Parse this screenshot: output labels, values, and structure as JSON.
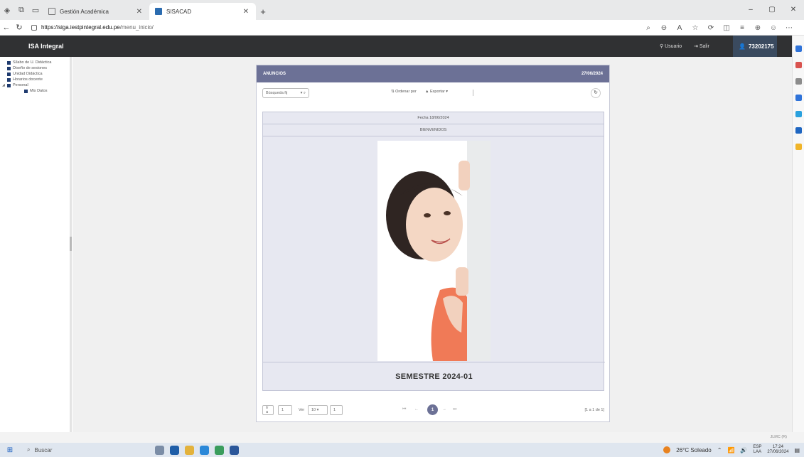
{
  "browser": {
    "tabs": [
      {
        "label": "Gestión Académica",
        "active": false
      },
      {
        "label": "SISACAD",
        "active": true
      }
    ],
    "new_tab": "+",
    "url_host": "https://siga.iestpintegral.edu.pe",
    "url_path": "/menu_inicio/",
    "win_min": "–",
    "win_max": "▢",
    "win_close": "✕"
  },
  "header": {
    "brand": "ISA Integral",
    "usuario": "Usuario",
    "salir": "Salir",
    "user_code": "73202175"
  },
  "sidebar": {
    "items": [
      {
        "label": "Sílabo de U. Didáctica",
        "level": 1
      },
      {
        "label": "Diseño de sesiones",
        "level": 1
      },
      {
        "label": "Unidad Didáctica",
        "level": 1
      },
      {
        "label": "Horarios docente",
        "level": 1
      },
      {
        "label": "Personal",
        "level": 1,
        "expanded": true
      },
      {
        "label": "Mis Datos",
        "level": 2
      }
    ]
  },
  "panel": {
    "title": "ANUNCIOS",
    "date": "27/06/2024",
    "search_placeholder": "Búsqueda fij",
    "order_label": "Ordenar por",
    "export_label": "Exportar",
    "fecha_row": "Fecha 18/06/2024",
    "welcome_row": "BIENVENIDOS",
    "semestre": "SEMESTRE 2024-01"
  },
  "pager": {
    "goto_label": "Ir a",
    "goto_value": "1",
    "ver_label": "Ver",
    "per_page": "10",
    "per_page_input": "1",
    "current_page": "1",
    "info": "[1 a 1 de 1]"
  },
  "footer": {
    "jlmc": "JLMC (R)"
  },
  "taskbar": {
    "search": "Buscar",
    "weather": "26°C Soleado",
    "lang": "ESP",
    "lang2": "LAA",
    "time": "17:24",
    "date": "27/06/2024"
  },
  "colors": {
    "header_bg": "#303133",
    "panel_accent": "#6c7196",
    "content_bg": "#e7e8f1"
  }
}
